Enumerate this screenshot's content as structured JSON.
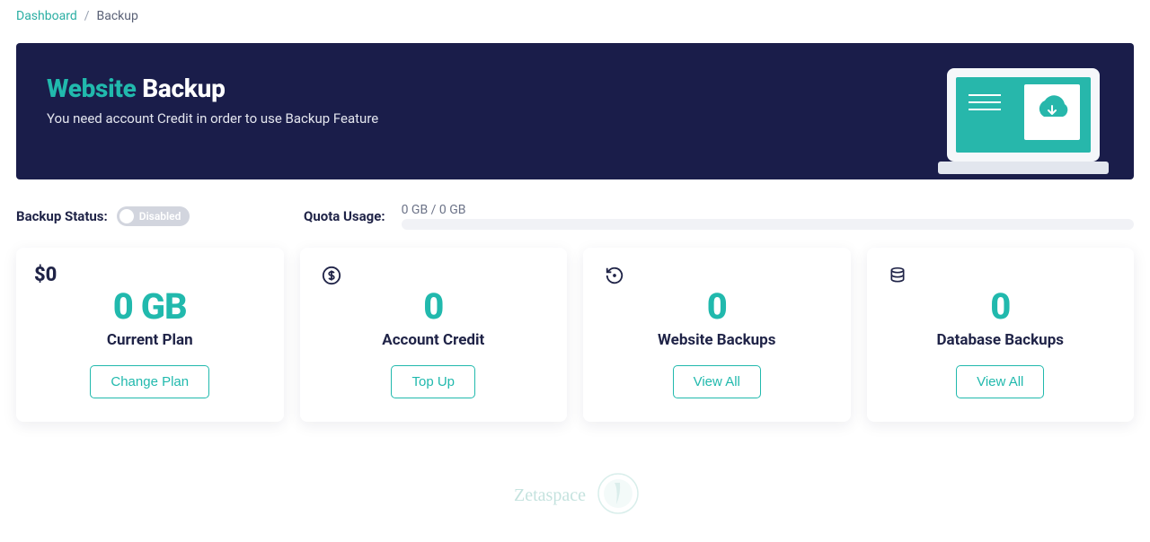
{
  "breadcrumb": {
    "parent": "Dashboard",
    "current": "Backup"
  },
  "hero": {
    "title_accent": "Website",
    "title_rest": "Backup",
    "subtitle": "You need account Credit in order to use Backup Feature"
  },
  "status": {
    "label": "Backup Status:",
    "toggle_text": "Disabled"
  },
  "quota": {
    "label": "Quota Usage:",
    "text": "0 GB / 0 GB"
  },
  "cards": {
    "plan": {
      "badge": "$0",
      "value": "0 GB",
      "title": "Current Plan",
      "button": "Change Plan"
    },
    "credit": {
      "value": "0",
      "title": "Account Credit",
      "button": "Top Up"
    },
    "website_backups": {
      "value": "0",
      "title": "Website Backups",
      "button": "View All"
    },
    "database_backups": {
      "value": "0",
      "title": "Database Backups",
      "button": "View All"
    }
  },
  "watermark": "Zetaspace"
}
